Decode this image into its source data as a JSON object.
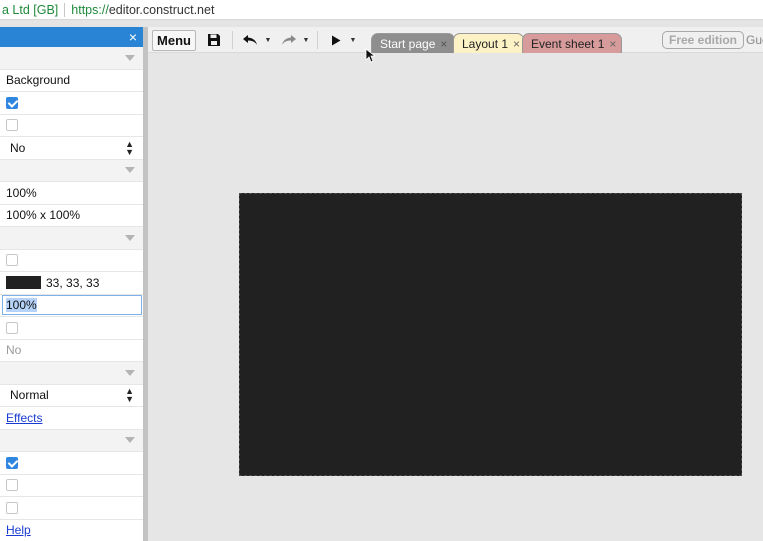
{
  "browser": {
    "cert_label": "a Ltd [GB]",
    "url_scheme": "https://",
    "url_host": "editor.construct.net"
  },
  "properties_panel": {
    "close_glyph": "×",
    "rows": {
      "name": "Background",
      "visible_checked": true,
      "transparent_checked": false,
      "select_value": "No",
      "scale": "100%",
      "size": "100% x 100%",
      "check_a_checked": false,
      "color_value": "33, 33, 33",
      "opacity": "100%",
      "check_b_checked": false,
      "no_value": "No",
      "blend_mode": "Normal",
      "effects_link": "Effects",
      "check_c_checked": true,
      "check_d_checked": false,
      "check_e_checked": false,
      "help_link": "Help"
    },
    "swatch_color": "#212121"
  },
  "toolbar": {
    "menu_label": "Menu",
    "tabs": [
      {
        "label": "Start page"
      },
      {
        "label": "Layout 1"
      },
      {
        "label": "Event sheet 1"
      }
    ],
    "tab_close_glyph": "×",
    "free_edition_label": "Free edition",
    "guest_label": "Gue"
  },
  "colors": {
    "panel_header": "#2a84d6",
    "layout_background": "#212121",
    "tab_layout": "#fdf2c5",
    "tab_event": "#d79b9b",
    "tab_start": "#8e8e8e"
  },
  "icons": [
    "close-icon",
    "chevron-down-icon",
    "save-icon",
    "undo-icon",
    "redo-icon",
    "play-icon",
    "caret-down-icon",
    "cursor-icon"
  ]
}
